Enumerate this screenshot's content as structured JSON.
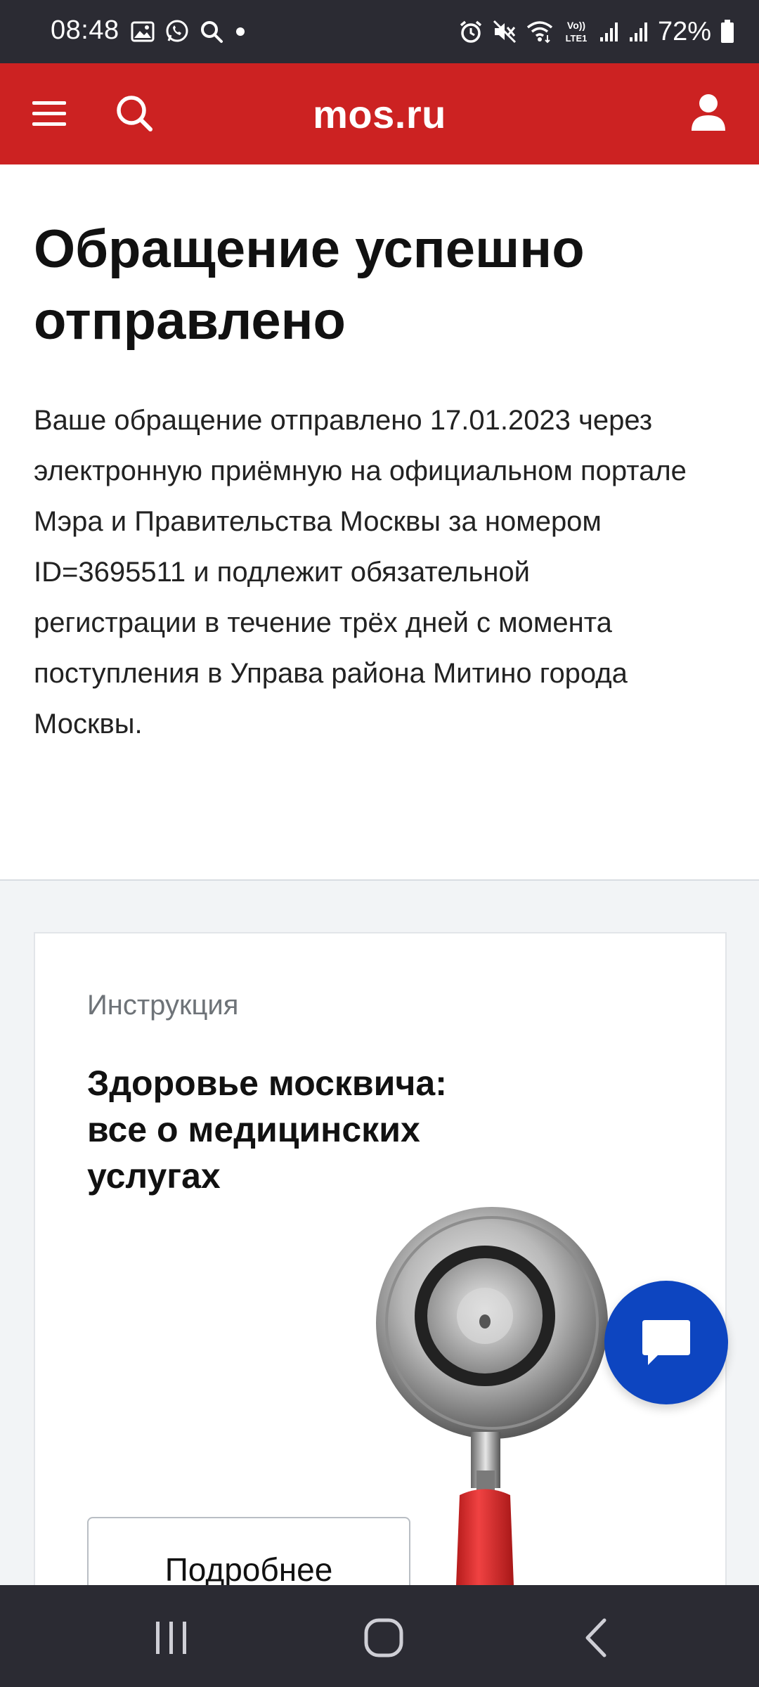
{
  "status_bar": {
    "time": "08:48",
    "battery": "72%",
    "network_label_top": "Vo))",
    "network_label_bottom": "LTE1",
    "left_icons": [
      "gallery-icon",
      "whatsapp-icon",
      "search-icon",
      "dot-icon"
    ],
    "right_icons": [
      "alarm-icon",
      "mute-icon",
      "wifi-icon",
      "volte-icon",
      "signal-icon",
      "signal-icon",
      "battery-icon"
    ]
  },
  "header": {
    "logo": "mos.ru",
    "bg_color": "#cc2222",
    "menu_icon": "hamburger-icon",
    "search_icon": "search-icon",
    "user_icon": "user-icon"
  },
  "main": {
    "title_line1": "Обращение успешно",
    "title_line2": "отправлено",
    "description_lines": [
      "Ваше обращение отправлено 17.01.2023 через",
      "электронную приёмную на официальном портале",
      "Мэра и Правительства Москвы за номером",
      "ID=3695511 и подлежит обязательной",
      "регистрации в течение трёх дней с момента",
      "поступления в Управа района Митино города",
      "Москвы."
    ]
  },
  "card": {
    "kicker": "Инструкция",
    "title_lines": [
      "Здоровье москвича:",
      "все о медицинских",
      "услугах"
    ],
    "button_label": "Подробнее",
    "image_icon": "stethoscope-illustration"
  },
  "chat_fab": {
    "icon": "chat-icon",
    "color": "#0d45c0"
  },
  "nav_bar": {
    "buttons": [
      "recents-icon",
      "home-icon",
      "back-icon"
    ]
  }
}
